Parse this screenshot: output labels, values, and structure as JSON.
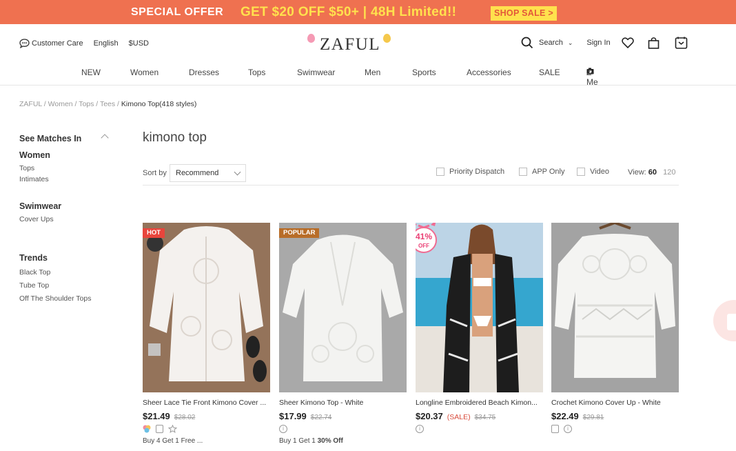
{
  "promo": {
    "special": "SPECIAL OFFER",
    "deal": "GET $20 OFF $50+  |  48H Limited!!",
    "button": "SHOP SALE >"
  },
  "header": {
    "customer_care": "Customer Care",
    "language": "English",
    "currency": "$USD",
    "logo": "ZAFUL",
    "search": "Search",
    "signin": "Sign In"
  },
  "nav": [
    "NEW",
    "Women",
    "Dresses",
    "Tops",
    "Swimwear",
    "Men",
    "Sports",
    "Accessories",
    "SALE",
    "Z-Me"
  ],
  "breadcrumb": {
    "items": [
      "ZAFUL",
      "Women",
      "Tops",
      "Tees"
    ],
    "current": "Kimono Top(418 styles)"
  },
  "sidebar": {
    "title": "See Matches In",
    "groups": [
      {
        "title": "Women",
        "links": [
          "Tops",
          "Intimates"
        ]
      },
      {
        "title": "Swimwear",
        "links": [
          "Cover Ups"
        ]
      },
      {
        "title": "Trends",
        "links": [
          "Black Top",
          "Tube Top",
          "Off The Shoulder Tops"
        ]
      }
    ]
  },
  "results": {
    "title": "kimono top",
    "sort_label": "Sort by",
    "sort_value": "Recommend",
    "filters": [
      "Priority Dispatch",
      "APP Only",
      "Video"
    ],
    "view_label": "View:",
    "view_selected": "60",
    "view_other": "120"
  },
  "products": [
    {
      "badge": "HOT",
      "badge_color": "#e8453c",
      "name": "Sheer Lace Tie Front Kimono Cover ...",
      "price": "$21.49",
      "old_price": "$28.02",
      "sale_tag": "",
      "promo": "Buy 4 Get 1 Free ..."
    },
    {
      "badge": "POPULAR",
      "badge_color": "#b86d28",
      "name": "Sheer Kimono Top - White",
      "price": "$17.99",
      "old_price": "$22.74",
      "sale_tag": "",
      "promo": "Buy 1 Get 1 30% Off"
    },
    {
      "badge": "",
      "badge_color": "",
      "off_pct": "41%",
      "off_word": "OFF",
      "name": "Longline Embroidered Beach Kimon...",
      "price": "$20.37",
      "old_price": "$34.75",
      "sale_tag": "(SALE)",
      "promo": ""
    },
    {
      "badge": "",
      "badge_color": "",
      "name": "Crochet Kimono Cover Up - White",
      "price": "$22.49",
      "old_price": "$29.81",
      "sale_tag": "",
      "promo": ""
    }
  ]
}
